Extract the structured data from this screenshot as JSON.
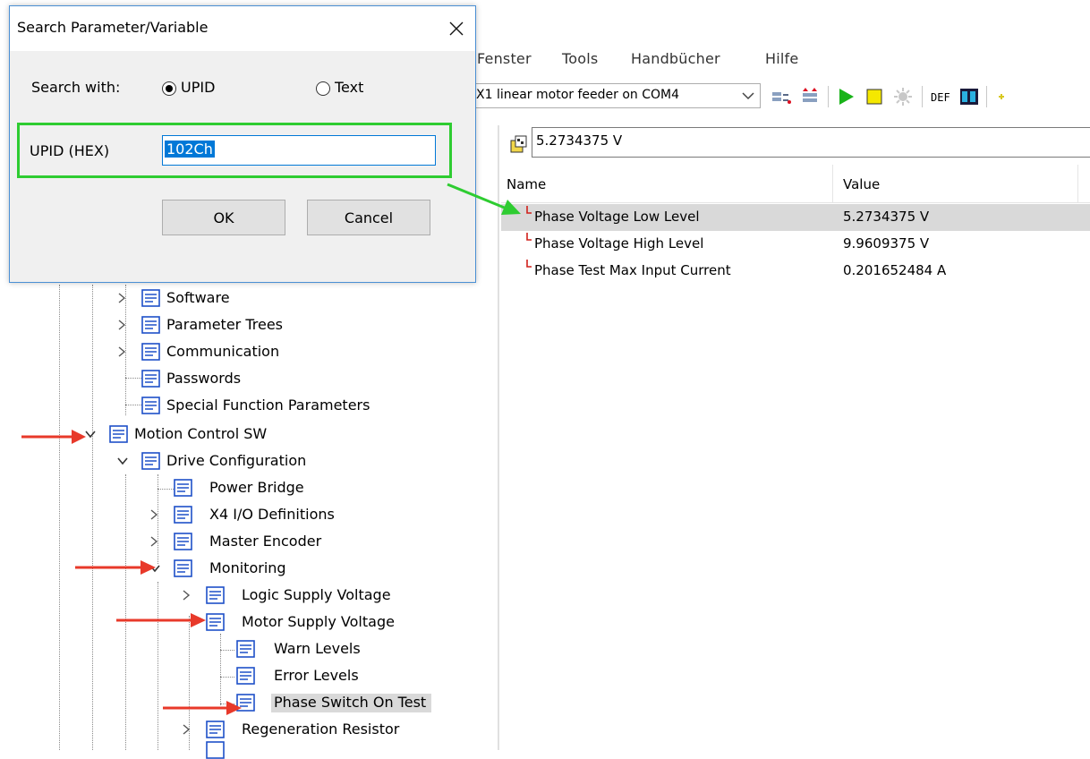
{
  "menu": {
    "items": [
      "Fenster",
      "Tools",
      "Handbücher",
      "Hilfe"
    ]
  },
  "toolbar": {
    "device": "X1 linear motor feeder on COM4",
    "def_label": "DEF"
  },
  "dialog": {
    "title": "Search Parameter/Variable",
    "search_with_label": "Search with:",
    "option_upid": "UPID",
    "option_text": "Text",
    "selected_option": "UPID",
    "upid_label": "UPID (HEX)",
    "upid_value": "102Ch",
    "ok_label": "OK",
    "cancel_label": "Cancel"
  },
  "value_field": "5.2734375 V",
  "grid": {
    "columns": [
      "Name",
      "Value"
    ],
    "rows": [
      {
        "name": "Phase Voltage Low Level",
        "value": "5.2734375 V"
      },
      {
        "name": "Phase Voltage High Level",
        "value": "9.9609375 V"
      },
      {
        "name": "Phase Test Max Input Current",
        "value": "0.201652484 A"
      }
    ]
  },
  "tree": {
    "items": [
      "Software",
      "Parameter Trees",
      "Communication",
      "Passwords",
      "Special Function Parameters",
      "Motion Control SW",
      "Drive Configuration",
      "Power Bridge",
      "X4 I/O Definitions",
      "Master Encoder",
      "Monitoring",
      "Logic Supply Voltage",
      "Motor Supply Voltage",
      "Warn Levels",
      "Error Levels",
      "Phase Switch On Test",
      "Regeneration Resistor"
    ]
  },
  "colors": {
    "annotation_arrow": "#e8392a",
    "highlight_arrow": "#2ecc31",
    "selection": "#d9d9d9",
    "node_icon": "#1e50c8"
  }
}
